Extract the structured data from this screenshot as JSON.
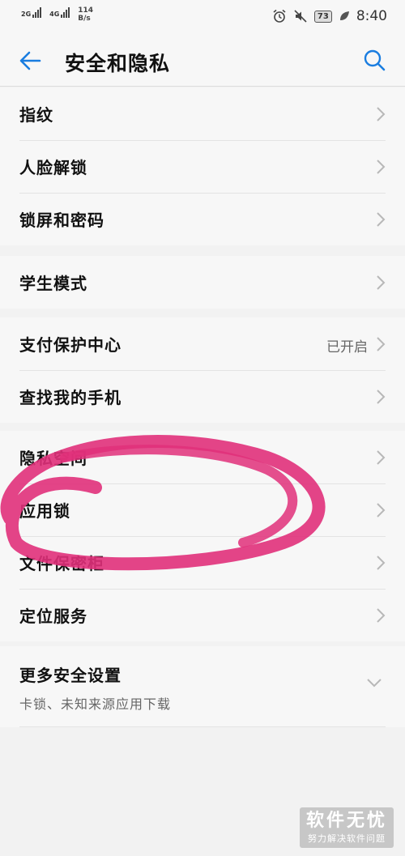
{
  "status_bar": {
    "net1": "2G",
    "net2": "4G",
    "speed_value": "114",
    "speed_unit": "B/s",
    "battery": "73",
    "time": "8:40"
  },
  "header": {
    "title": "安全和隐私"
  },
  "groups": [
    {
      "items": [
        {
          "label": "指纹"
        },
        {
          "label": "人脸解锁"
        },
        {
          "label": "锁屏和密码"
        }
      ]
    },
    {
      "items": [
        {
          "label": "学生模式"
        }
      ]
    },
    {
      "items": [
        {
          "label": "支付保护中心",
          "value": "已开启"
        },
        {
          "label": "查找我的手机"
        }
      ]
    },
    {
      "items": [
        {
          "label": "隐私空间"
        },
        {
          "label": "应用锁"
        },
        {
          "label": "文件保密柜"
        },
        {
          "label": "定位服务"
        }
      ]
    },
    {
      "items": [
        {
          "label": "更多安全设置",
          "sub": "卡锁、未知来源应用下载"
        }
      ]
    }
  ],
  "watermark": {
    "main": "软件无忧",
    "sub": "努力解决软件问题"
  },
  "colors": {
    "accent": "#1a7de0",
    "annotation": "#e0307a",
    "background": "#f2f2f2",
    "surface": "#f7f7f7"
  }
}
